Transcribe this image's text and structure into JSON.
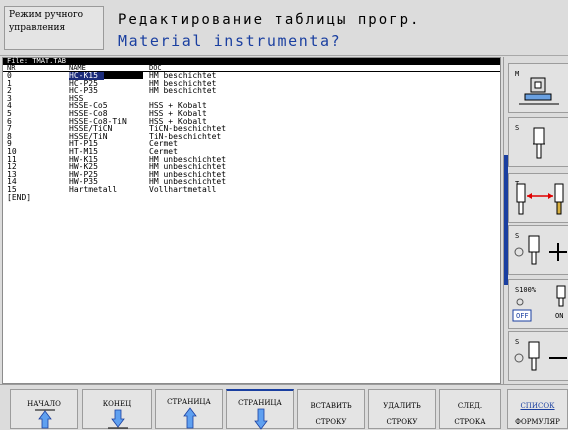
{
  "header": {
    "mode_line1": "Режим ручного",
    "mode_line2": "управления",
    "title": "Редактирование таблицы прогр.",
    "prompt": "Material instrumenta?"
  },
  "table": {
    "file_label": "File: TMAT.TAB",
    "columns": {
      "nr": "NR",
      "name": "NAME",
      "doc": "DOC"
    },
    "rows": [
      {
        "nr": "0",
        "name": "HC-K15",
        "doc": "HM beschichtet"
      },
      {
        "nr": "1",
        "name": "HC-P25",
        "doc": "HM beschichtet"
      },
      {
        "nr": "2",
        "name": "HC-P35",
        "doc": "HM beschichtet"
      },
      {
        "nr": "3",
        "name": "HSS",
        "doc": ""
      },
      {
        "nr": "4",
        "name": "HSSE-Co5",
        "doc": "HSS + Kobalt"
      },
      {
        "nr": "5",
        "name": "HSSE-Co8",
        "doc": "HSS + Kobalt"
      },
      {
        "nr": "6",
        "name": "HSSE-Co8-TiN",
        "doc": "HSS + Kobalt"
      },
      {
        "nr": "7",
        "name": "HSSE/TiCN",
        "doc": "TiCN-beschichtet"
      },
      {
        "nr": "8",
        "name": "HSSE/TiN",
        "doc": "TiN-beschichtet"
      },
      {
        "nr": "9",
        "name": "HT-P15",
        "doc": "Cermet"
      },
      {
        "nr": "10",
        "name": "HT-M15",
        "doc": "Cermet"
      },
      {
        "nr": "11",
        "name": "HW-K15",
        "doc": "HM unbeschichtet"
      },
      {
        "nr": "12",
        "name": "HW-K25",
        "doc": "HM unbeschichtet"
      },
      {
        "nr": "13",
        "name": "HW-P25",
        "doc": "HM unbeschichtet"
      },
      {
        "nr": "14",
        "name": "HW-P35",
        "doc": "HM unbeschichtet"
      },
      {
        "nr": "15",
        "name": "Hartmetall",
        "doc": "Vollhartmetall"
      }
    ],
    "end_label": "[END]",
    "selected_row": 0
  },
  "side_panel": {
    "m_label": "M",
    "s_label": "S",
    "t_label": "T",
    "s_plus_label": "S",
    "feed_label": "S100%",
    "feed_off": "OFF",
    "feed_on": "ON",
    "s_minus_label": "S",
    "accent_color": "#1a3fa0"
  },
  "softkeys": [
    {
      "line1": "НАЧАЛО",
      "line2": "",
      "icon": "arrow-up-to-top-icon"
    },
    {
      "line1": "КОНЕЦ",
      "line2": "",
      "icon": "arrow-down-to-bottom-icon"
    },
    {
      "line1": "СТРАНИЦА",
      "line2": "",
      "icon": "arrow-up-icon"
    },
    {
      "line1": "СТРАНИЦА",
      "line2": "",
      "icon": "arrow-down-icon"
    },
    {
      "line1": "ВСТАВИТЬ",
      "line2": "СТРОКУ",
      "icon": ""
    },
    {
      "line1": "УДАЛИТЬ",
      "line2": "СТРОКУ",
      "icon": ""
    },
    {
      "line1": "СЛЕД.",
      "line2": "СТРОКА",
      "icon": ""
    },
    {
      "line1": "СПИСОК",
      "line2": "ФОРМУЛЯР",
      "icon": ""
    }
  ]
}
